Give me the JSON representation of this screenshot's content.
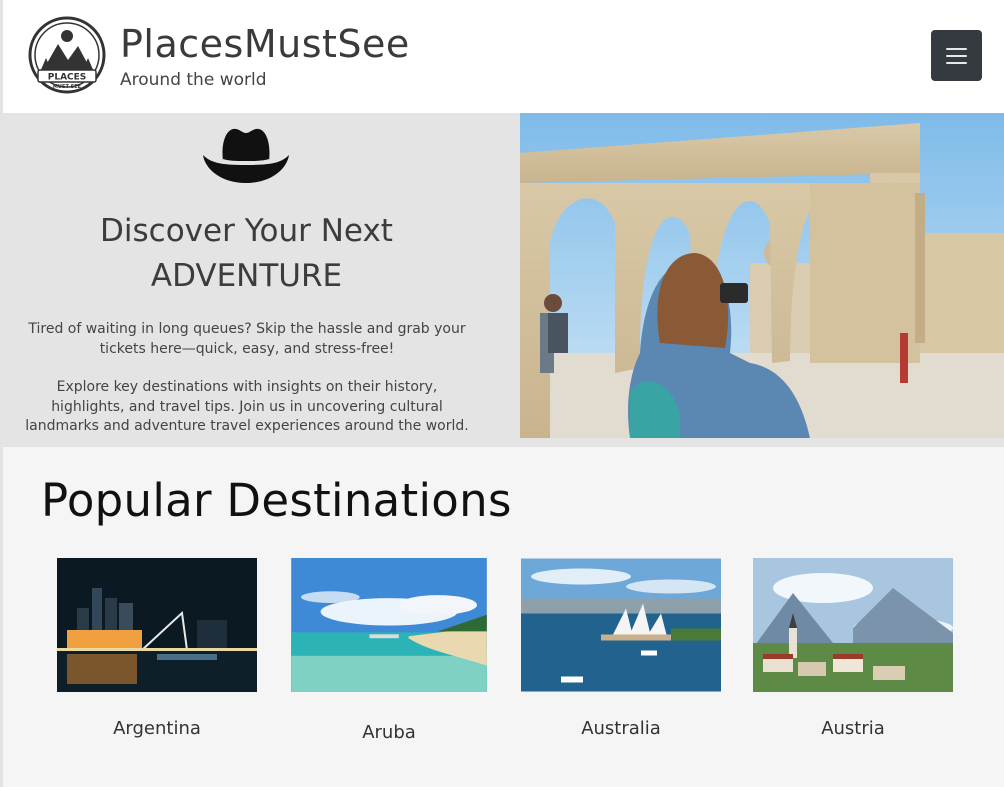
{
  "header": {
    "logo_text": "PLACES MUST SEE",
    "title": "PlacesMustSee",
    "subtitle": "Around the world",
    "menu_icon": "hamburger-menu-icon"
  },
  "hero": {
    "icon": "cowboy-hat-icon",
    "heading_line1": "Discover Your Next",
    "heading_line2": "ADVENTURE",
    "paragraph1": "Tired of waiting in long queues? Skip the hassle and grab your tickets here—quick, easy, and stress-free!",
    "paragraph2": "Explore key destinations with insights on their history, highlights, and travel tips. Join us in uncovering cultural landmarks and adventure travel experiences around the world."
  },
  "destinations": {
    "title": "Popular Destinations",
    "items": [
      {
        "name": "Argentina"
      },
      {
        "name": "Aruba"
      },
      {
        "name": "Australia"
      },
      {
        "name": "Austria"
      }
    ]
  },
  "colors": {
    "header_bg": "#ffffff",
    "hero_bg": "#e4e4e4",
    "menu_button": "#343a40",
    "page_bg": "#f5f5f5"
  }
}
